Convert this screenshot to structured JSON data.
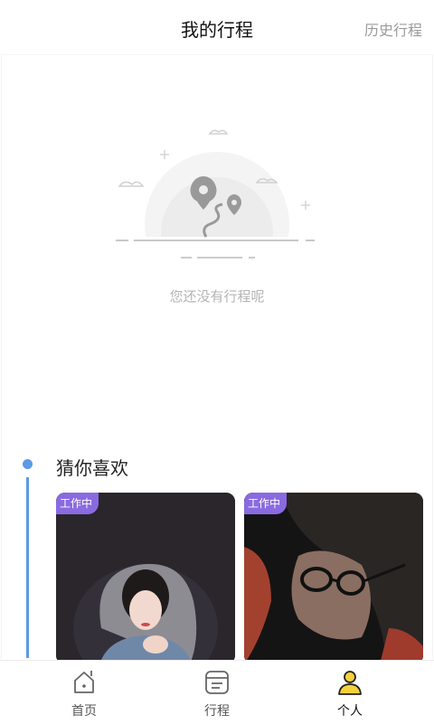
{
  "header": {
    "title": "我的行程",
    "history_label": "历史行程"
  },
  "empty_state": {
    "message": "您还没有行程呢"
  },
  "recommend": {
    "title": "猜你喜欢",
    "cards": [
      {
        "badge": "工作中"
      },
      {
        "badge": "工作中"
      }
    ]
  },
  "tabbar": {
    "items": [
      {
        "label": "首页",
        "icon": "home-icon"
      },
      {
        "label": "行程",
        "icon": "itinerary-icon"
      },
      {
        "label": "个人",
        "icon": "person-icon",
        "active": true
      }
    ]
  },
  "colors": {
    "accent_blue": "#5b9be6",
    "badge_purple": "#8a6ae0",
    "person_icon_yellow": "#f5d23a"
  }
}
